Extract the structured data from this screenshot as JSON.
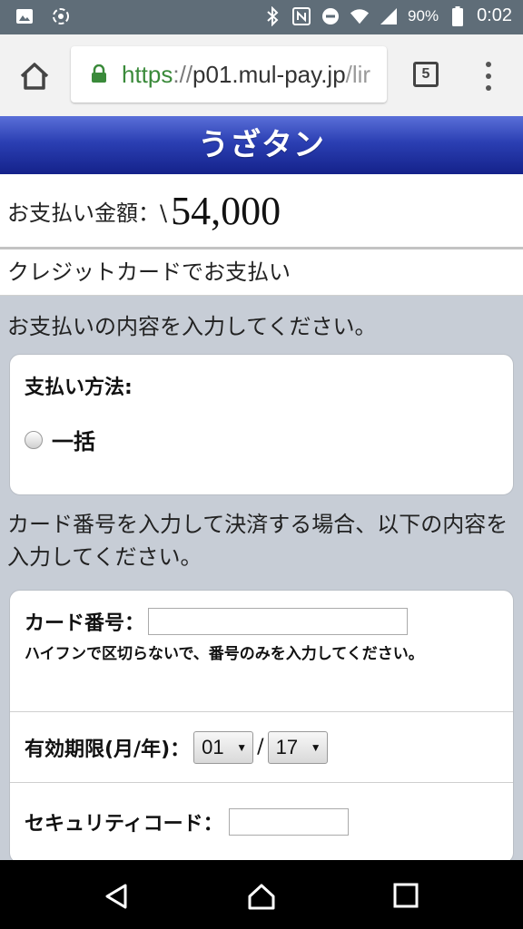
{
  "status_bar": {
    "battery_percent": "90%",
    "time": "0:02",
    "icons": [
      "image-icon",
      "sync-icon",
      "bluetooth-icon",
      "nfc-icon",
      "do-not-disturb-icon",
      "wifi-icon",
      "signal-icon",
      "battery-icon"
    ]
  },
  "browser": {
    "url_protocol": "https",
    "url_separator": "://",
    "url_host": "p01.mul-pay.jp",
    "url_path": "/lir",
    "tab_count": "5",
    "colors": {
      "secure": "#3a8a3a"
    }
  },
  "page": {
    "header_title": "うざタン",
    "amount_label": "お支払い金額：\\",
    "amount_value": "54,000",
    "payment_type": "クレジットカードでお支払い",
    "instruction": "お支払いの内容を入力してください。",
    "payment_method": {
      "title": "支払い方法:",
      "option_label": "一括",
      "option_selected": false
    },
    "card_instruction": "カード番号を入力して決済する場合、以下の内容を入力してください。",
    "card_form": {
      "card_number_label": "カード番号：",
      "card_number_value": "",
      "card_number_hint": "ハイフンで区切らないで、番号のみを入力してください。",
      "expiry_label": "有効期限(月/年)：",
      "expiry_month": "01",
      "expiry_separator": "/",
      "expiry_year": "17",
      "security_code_label": "セキュリティコード：",
      "security_code_value": ""
    },
    "colors": {
      "header_top": "#5a6fd8",
      "header_bottom": "#14228a",
      "background": "#c7cdd6"
    }
  },
  "nav_bar": {
    "buttons": [
      "back-icon",
      "home-icon",
      "recent-apps-icon"
    ]
  }
}
